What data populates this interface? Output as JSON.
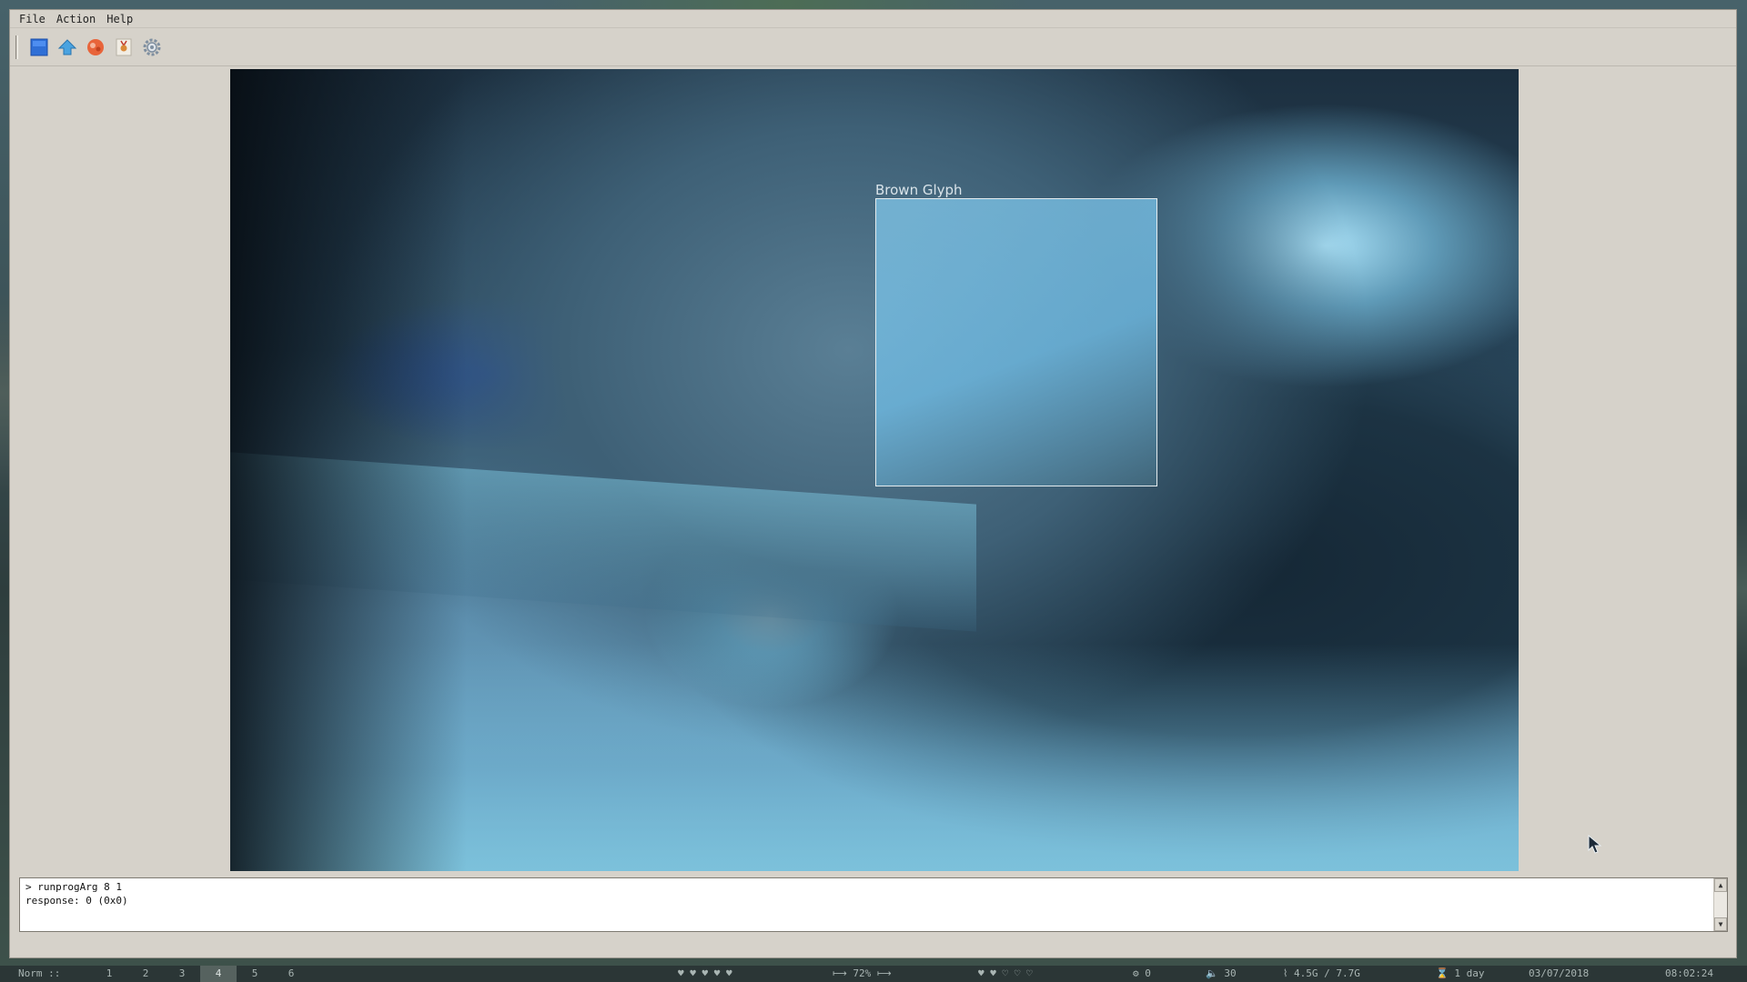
{
  "menu": {
    "items": [
      "File",
      "Action",
      "Help"
    ]
  },
  "toolbar": {
    "buttons": [
      {
        "name": "camera-view",
        "icon": "blue-square-icon",
        "color": "#2f6fd6"
      },
      {
        "name": "home",
        "icon": "home-arrow-icon",
        "color": "#4aa3e0"
      },
      {
        "name": "record",
        "icon": "record-blob-icon",
        "color": "#e8643a"
      },
      {
        "name": "badge",
        "icon": "medal-icon",
        "color": "#d98a3a"
      },
      {
        "name": "settings",
        "icon": "gear-icon",
        "color": "#7f8fa0"
      }
    ]
  },
  "viewer": {
    "detection_label": "Brown Glyph"
  },
  "console": {
    "lines": [
      "> runprogArg 8 1",
      "response: 0 (0x0)"
    ]
  },
  "statusbar": {
    "mode": "Norm ::",
    "workspaces": [
      "1",
      "2",
      "3",
      "4",
      "5",
      "6"
    ],
    "active_workspace": "4",
    "hearts_left": "♥ ♥ ♥ ♥ ♥",
    "brightness": "72%",
    "hearts_right": "♥ ♥ ♡ ♡ ♡",
    "notifications": "0",
    "volume": "30",
    "memory": "4.5G / 7.7G",
    "uptime": "1 day",
    "date": "03/07/2018",
    "time": "08:02:24"
  }
}
